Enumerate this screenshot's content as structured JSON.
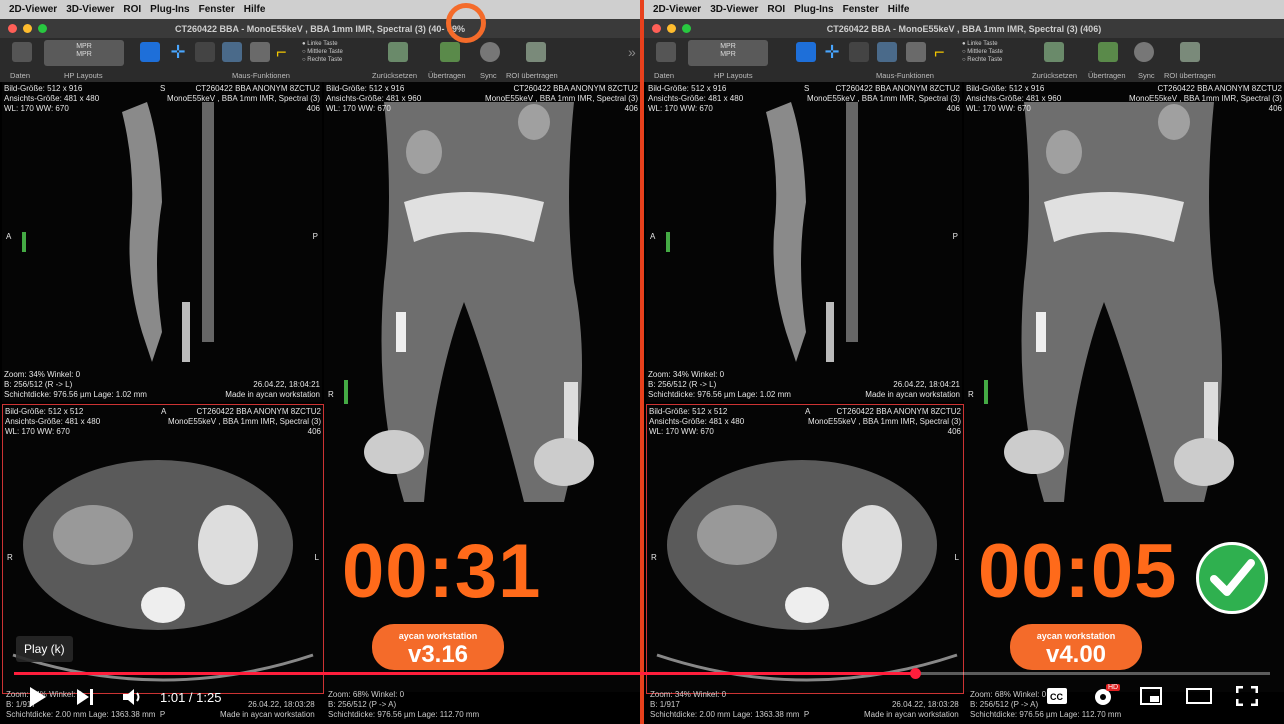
{
  "menu": [
    "2D-Viewer",
    "3D-Viewer",
    "ROI",
    "Plug-Ins",
    "Fenster",
    "Hilfe"
  ],
  "left": {
    "title": "CT260422 BBA - MonoE55keV , BBA 1mm IMR, Spectral (3) (40",
    "title_suffix": " - 89%",
    "timer": "00:31",
    "badge_top": "aycan workstation",
    "badge_version": "v3.16"
  },
  "right": {
    "title": "CT260422 BBA - MonoE55keV , BBA 1mm IMR, Spectral (3) (406)",
    "timer": "00:05",
    "badge_top": "aycan workstation",
    "badge_version": "v4.00"
  },
  "toolbar": {
    "mpr1": "MPR",
    "mpr2": "MPR",
    "radio1": "Linke Taste",
    "radio2": "Mittlere Taste",
    "radio3": "Rechte Taste",
    "labels": {
      "daten": "Daten",
      "hp": "HP Layouts",
      "maus": "Maus-Funktionen",
      "zurueck": "Zurücksetzen",
      "uebertragen": "Übertragen",
      "sync": "Sync",
      "roi": "ROI übertragen"
    }
  },
  "overlays": {
    "sag_tl": "Bild-Größe: 512 x 916\nAnsichts-Größe: 481 x 480\nWL: 170 WW: 670",
    "sag_tr": "CT260422 BBA ANONYM 8ZCTU2\nMonoE55keV , BBA 1mm IMR, Spectral (3)\n406",
    "sag_s": "S",
    "sag_a": "A",
    "sag_p": "P",
    "sag_bl": "Zoom: 34% Winkel: 0\nB: 256/512 (R -> L)\nSchichtdicke: 976.56 µm Lage: 1.02 mm",
    "sag_br": "26.04.22, 18:04:21\nMade in aycan workstation",
    "cor_tl": "Bild-Größe: 512 x 916\nAnsichts-Größe: 481 x 960\nWL: 170 WW: 670",
    "cor_r": "R",
    "ax_tl": "Bild-Größe: 512 x 512\nAnsichts-Größe: 481 x 480\nWL: 170 WW: 670",
    "ax_tr": "CT260422 BBA ANONYM 8ZCTU2\nMonoE55keV , BBA 1mm IMR, Spectral (3)\n406",
    "ax_a": "A",
    "ax_r": "R",
    "ax_l": "L",
    "bot_l": "Zoom: 34% Winkel: 0\nB: 1/917\nSchichtdicke: 2.00 mm Lage: 1363.38 mm  P",
    "bot_m": "Zoom: 68% Winkel: 0\nB: 256/512 (P -> A)\nSchichtdicke: 976.56 µm Lage: 112.70 mm",
    "bot_r": "26.04.22, 18:03:28\nMade in aycan workstation"
  },
  "player": {
    "tooltip": "Play (k)",
    "time": "1:01 / 1:25",
    "progress_fraction": 0.717,
    "hd": "HD"
  }
}
